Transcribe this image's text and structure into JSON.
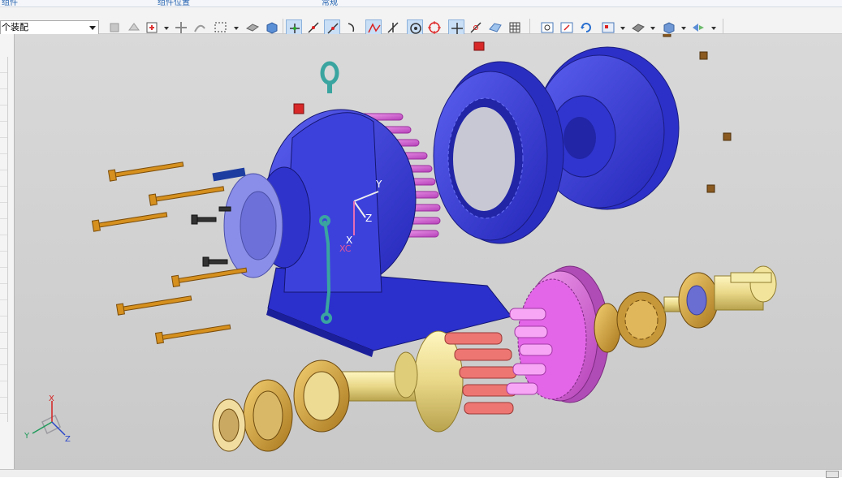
{
  "tabs": [
    {
      "label": "组件"
    },
    {
      "label": "组件位置"
    },
    {
      "label": "常规"
    }
  ],
  "filter": {
    "value": "个装配"
  },
  "triad": {
    "y_label": "Y",
    "z_label": "Z",
    "x_label": "X",
    "xc_label": "XC"
  },
  "view_axes": {
    "x": "X",
    "y": "Y",
    "z": "Z"
  },
  "colors": {
    "housing": "#3b3fd8",
    "pins": "#e463e6",
    "bolts": "#d5901e",
    "shaft": "#ecdc8c",
    "bearing": "#d4a640",
    "red_pins": "#ee7672",
    "viewport_bg": "#d4d4d4"
  }
}
